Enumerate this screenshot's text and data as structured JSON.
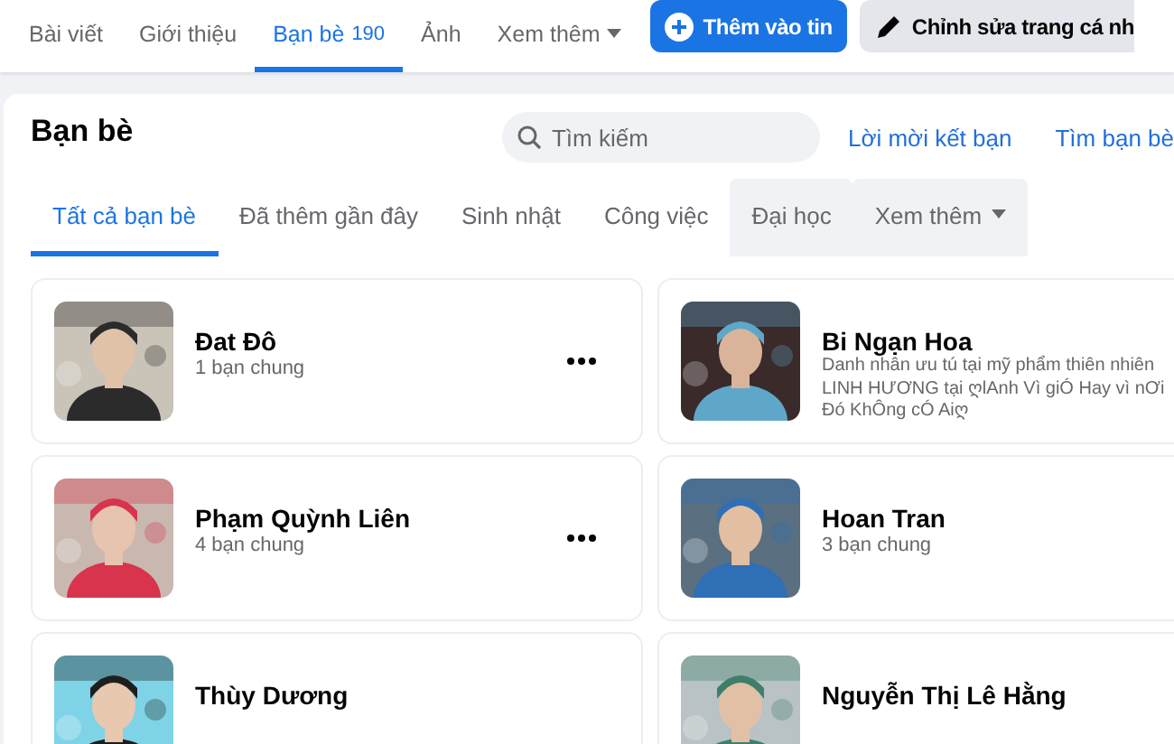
{
  "nav": {
    "tabs": [
      {
        "label": "Bài viết",
        "selected": false
      },
      {
        "label": "Giới thiệu",
        "selected": false
      },
      {
        "label": "Bạn bè",
        "count": "190",
        "selected": true
      },
      {
        "label": "Ảnh",
        "selected": false
      },
      {
        "label": "Xem thêm",
        "dropdown": true,
        "selected": false
      }
    ],
    "buttons": [
      {
        "label": "Thêm vào tin",
        "kind": "primary"
      },
      {
        "label": "Chỉnh sửa trang cá nh",
        "kind": "secondary"
      }
    ]
  },
  "friends": {
    "title": "Bạn bè",
    "search": {
      "placeholder": "Tìm kiếm"
    },
    "links": [
      "Lời mời kết bạn",
      "Tìm bạn bè"
    ],
    "tabs": [
      {
        "label": "Tất cả bạn bè",
        "selected": true,
        "highlighted": false
      },
      {
        "label": "Đã thêm gần đây",
        "selected": false,
        "highlighted": false
      },
      {
        "label": "Sinh nhật",
        "selected": false,
        "highlighted": false
      },
      {
        "label": "Công việc",
        "selected": false,
        "highlighted": false
      },
      {
        "label": "Đại học",
        "selected": false,
        "highlighted": true
      },
      {
        "label": "Xem thêm",
        "dropdown": true,
        "selected": false,
        "highlighted": true
      }
    ],
    "cards": [
      {
        "name": "Đat Đô",
        "mutual": "1 bạn chung",
        "more": true
      },
      {
        "name": "Bi Ngạn Hoa",
        "bio": "Danh nhân ưu tú tại mỹ phẩm thiên nhiên\nLINH HƯƠNG tại ღlAnh Vì giÓ Hay vì nƠi\nĐó KhÔng cÓ Aiღ",
        "more": false
      },
      {
        "name": "Phạm Quỳnh Liên",
        "mutual": "4 bạn chung",
        "more": true
      },
      {
        "name": "Hoan Tran",
        "mutual": "3 bạn chung",
        "more": false
      },
      {
        "name": "Thùy Dương",
        "more": false
      },
      {
        "name": "Nguyễn Thị Lê Hằng",
        "more": false
      }
    ]
  }
}
